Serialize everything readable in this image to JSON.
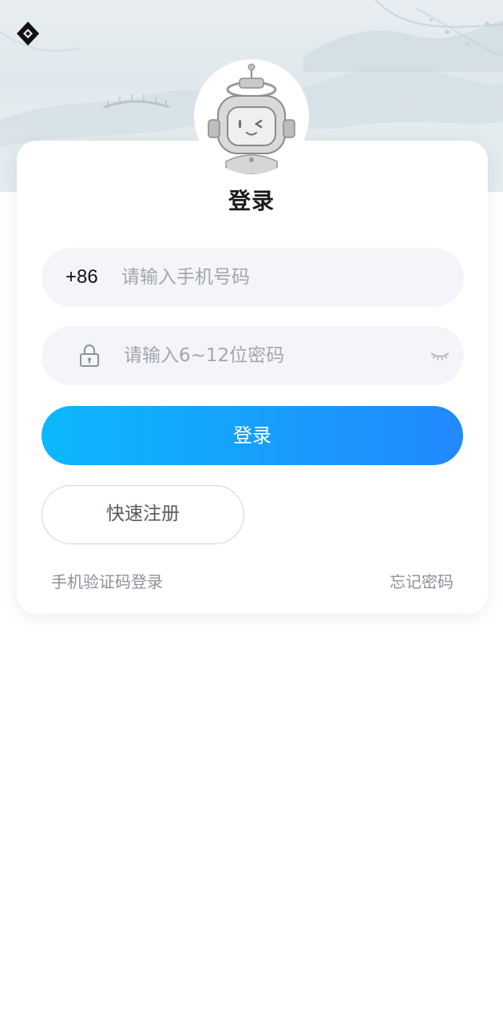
{
  "header": {
    "logo_icon": "diamond-logo-icon"
  },
  "avatar": {
    "icon": "robot-mascot-icon"
  },
  "title": "登录",
  "phone_field": {
    "country_code": "+86",
    "placeholder": "请输入手机号码",
    "value": ""
  },
  "password_field": {
    "icon": "lock-icon",
    "placeholder": "请输入6~12位密码",
    "value": "",
    "toggle_icon": "eye-closed-icon"
  },
  "buttons": {
    "login": "登录",
    "register": "快速注册"
  },
  "links": {
    "sms_login": "手机验证码登录",
    "forgot_password": "忘记密码"
  },
  "colors": {
    "login_gradient_start": "#0bb8fb",
    "login_gradient_end": "#2288ff",
    "field_background": "#f4f5f9",
    "placeholder": "#a3a6ad"
  }
}
